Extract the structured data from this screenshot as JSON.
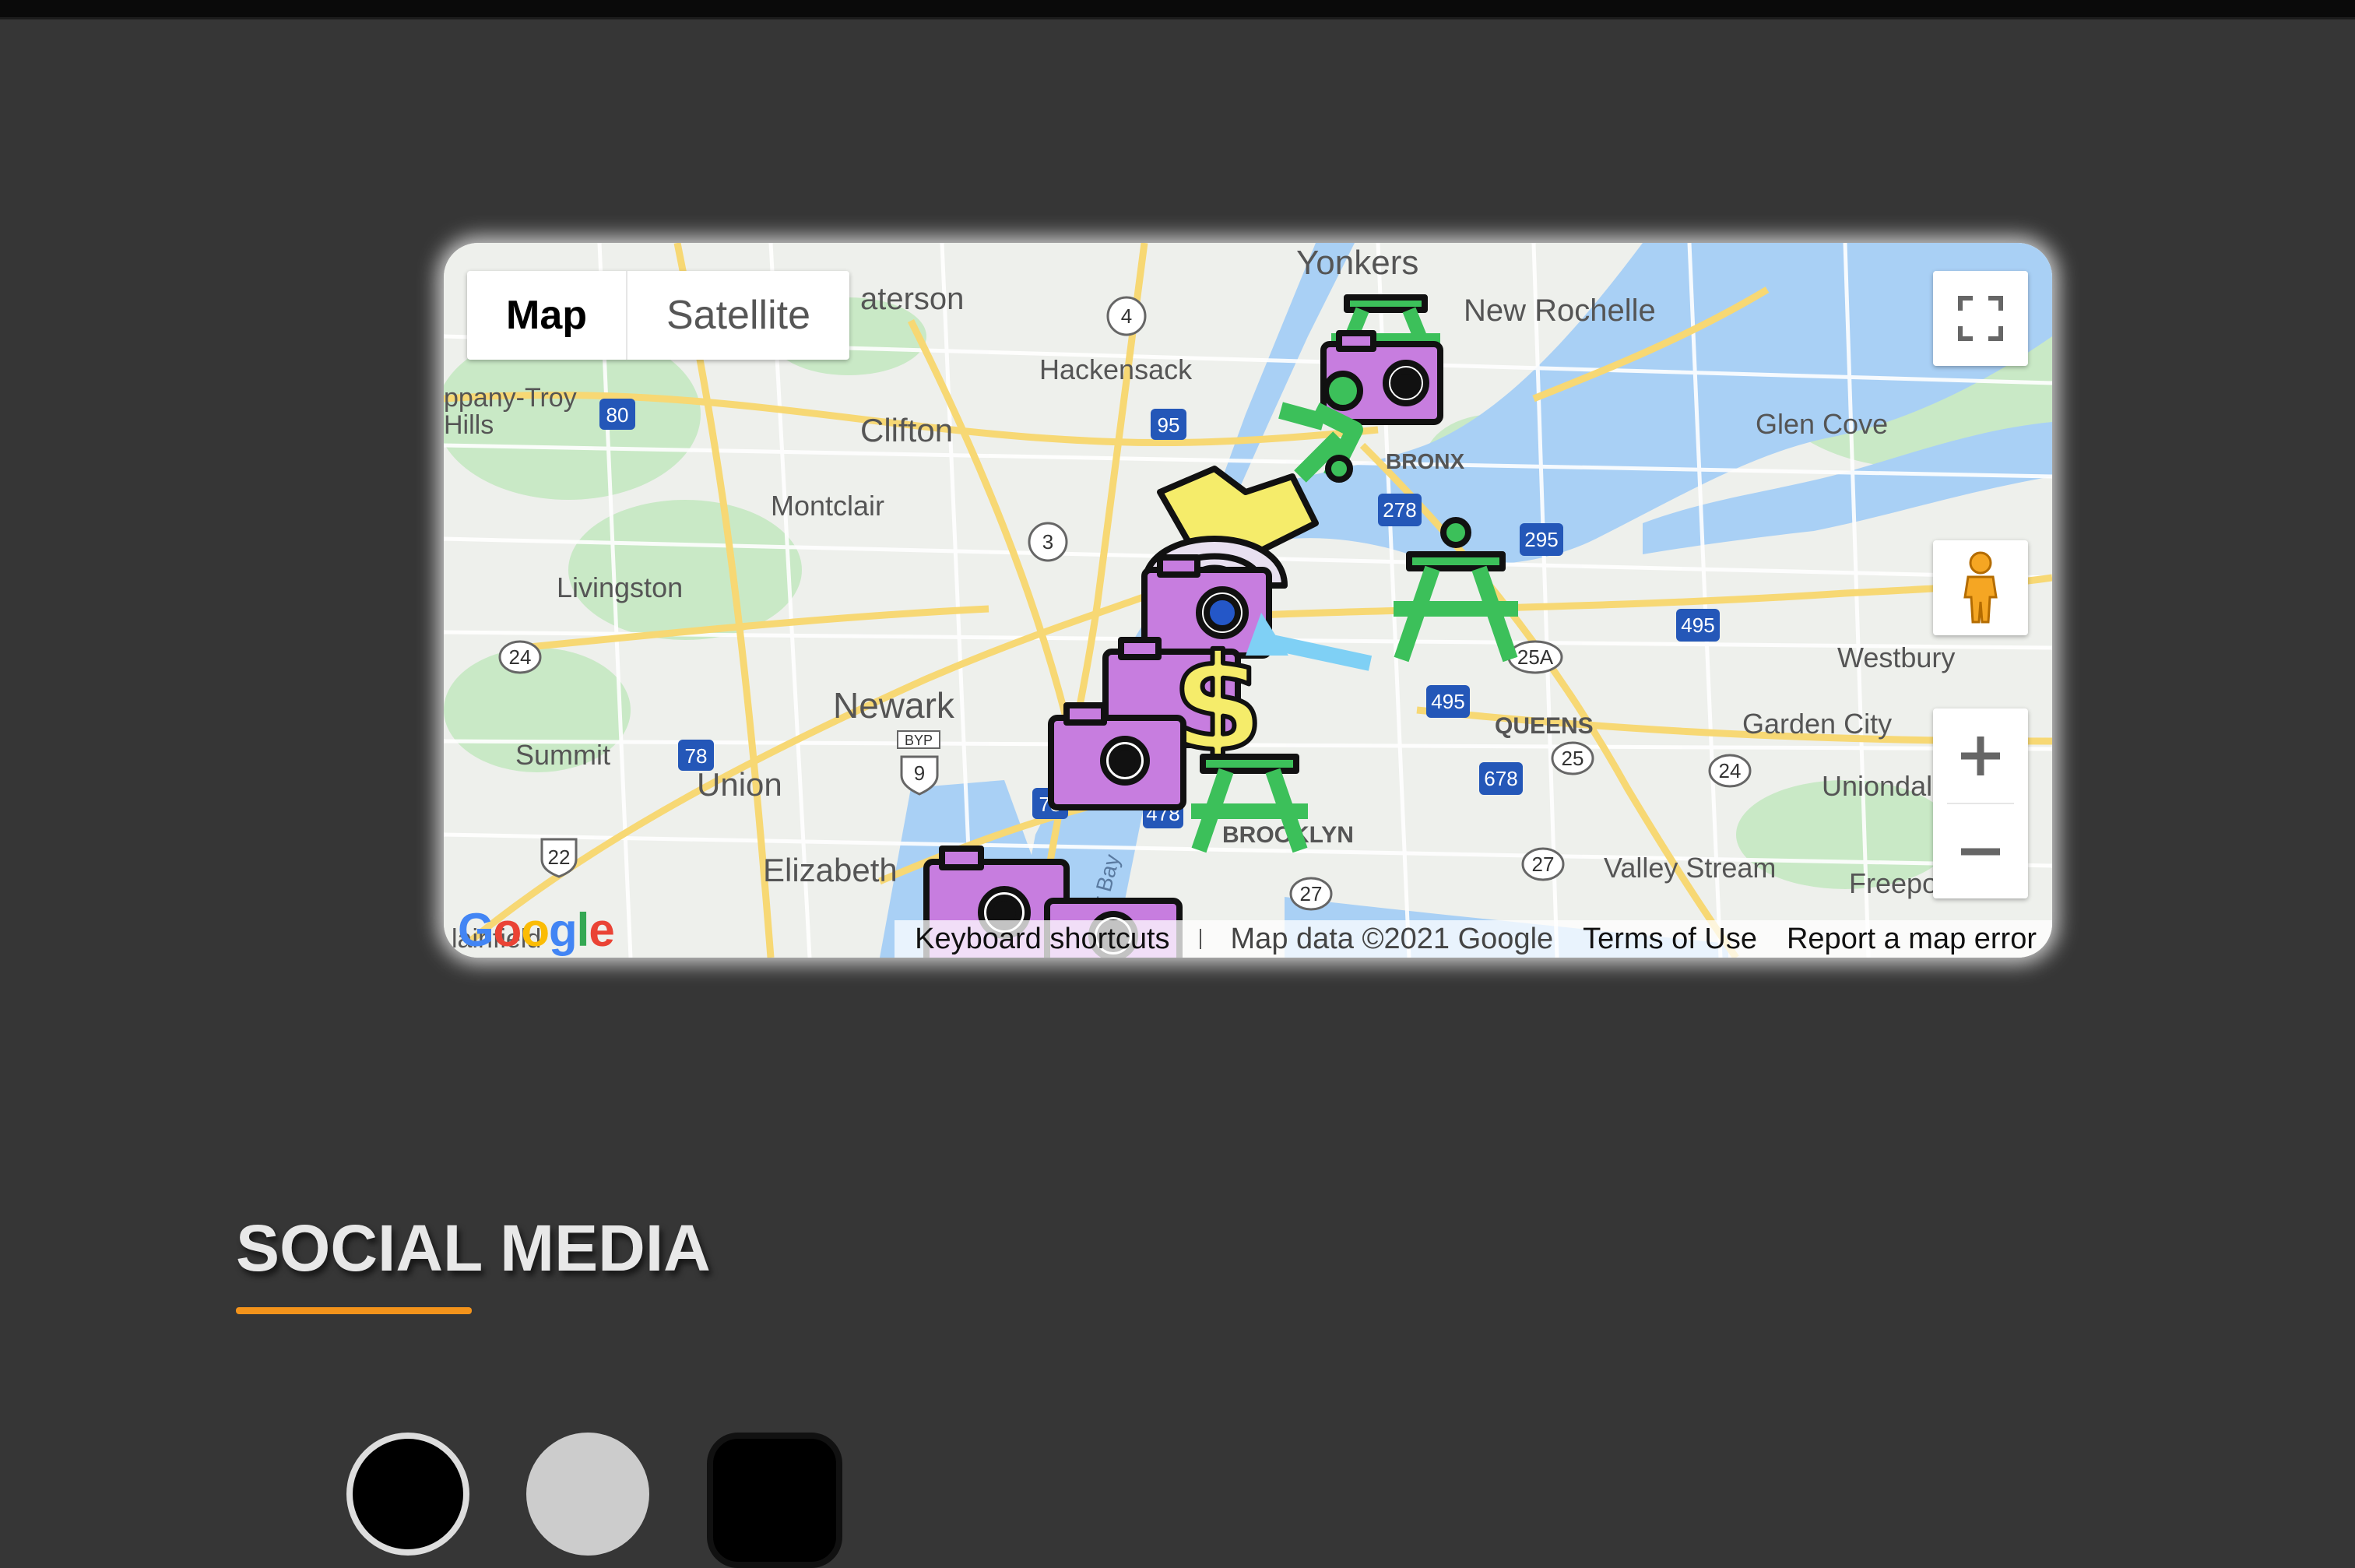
{
  "map": {
    "type_control": {
      "map_label": "Map",
      "satellite_label": "Satellite"
    },
    "places": {
      "yonkers": "Yonkers",
      "new_rochelle": "New Rochelle",
      "paterson": "aterson",
      "hackensack": "Hackensack",
      "parsippany": "ppany-Troy",
      "hills": "Hills",
      "clifton": "Clifton",
      "glen_cove": "Glen Cove",
      "montclair": "Montclair",
      "bronx": "BRONX",
      "livingston": "Livingston",
      "westbury": "Westbury",
      "newark": "Newark",
      "queens": "QUEENS",
      "garden_city": "Garden City",
      "summit": "Summit",
      "union": "Union",
      "uniondale": "Uniondal",
      "elizabeth": "Elizabeth",
      "brooklyn": "BROOKLYN",
      "valley_stream": "Valley Stream",
      "freeport": "Freepo",
      "plainfield": "lainfield"
    },
    "routes": [
      "4",
      "80",
      "95",
      "3",
      "278",
      "295",
      "495",
      "24",
      "25A",
      "495",
      "78",
      "9",
      "25",
      "24",
      "678",
      "22",
      "78",
      "478",
      "27",
      "27"
    ],
    "route_extra": {
      "byp": "BYP",
      "bay": "r Bay"
    },
    "attribution": {
      "shortcuts": "Keyboard shortcuts",
      "data": "Map data ©2021 Google",
      "terms": "Terms of Use",
      "report": "Report a map error"
    },
    "logo": "Google"
  },
  "social": {
    "title": "SOCIAL MEDIA"
  },
  "colors": {
    "background": "#363636",
    "accent": "#f3931b",
    "water": "#a9d0f5",
    "park": "#c5e8c5",
    "marker_camera": "#c77ddf",
    "marker_park": "#3cc05a",
    "marker_money": "#f5ec6a"
  }
}
